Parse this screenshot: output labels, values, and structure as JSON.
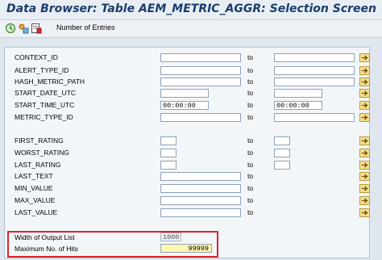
{
  "title": "Data Browser: Table AEM_METRIC_AGGR: Selection Screen",
  "toolbar": {
    "icons": [
      "execute-clock-icon",
      "selection-options-icon",
      "program-variant-icon"
    ],
    "entries_label": "Number of Entries"
  },
  "fields": [
    {
      "label": "CONTEXT_ID",
      "low": "",
      "to": "to",
      "high": ""
    },
    {
      "label": "ALERT_TYPE_ID",
      "low": "",
      "to": "to",
      "high": ""
    },
    {
      "label": "HASH_METRIC_PATH",
      "low": "",
      "to": "to",
      "high": ""
    },
    {
      "label": "START_DATE_UTC",
      "low": "",
      "to": "to",
      "high": ""
    },
    {
      "label": "START_TIME_UTC",
      "low": "00:00:00",
      "to": "to",
      "high": "00:00:00"
    },
    {
      "label": "METRIC_TYPE_ID",
      "low": "",
      "to": "to",
      "high": ""
    },
    {
      "label": "FIRST_RATING",
      "low": "",
      "to": "to",
      "high": ""
    },
    {
      "label": "WORST_RATING",
      "low": "",
      "to": "to",
      "high": ""
    },
    {
      "label": "LAST_RATING",
      "low": "",
      "to": "to",
      "high": ""
    },
    {
      "label": "LAST_TEXT",
      "low": "",
      "to": "to",
      "high": ""
    },
    {
      "label": "MIN_VALUE",
      "low": "",
      "to": "to",
      "high": ""
    },
    {
      "label": "MAX_VALUE",
      "low": "",
      "to": "to",
      "high": ""
    },
    {
      "label": "LAST_VALUE",
      "low": "",
      "to": "to",
      "high": ""
    }
  ],
  "output": {
    "width_label": "Width of Output List",
    "width_value": "1000",
    "maxhits_label": "Maximum No. of Hits",
    "maxhits_value": "99999"
  },
  "colors": {
    "title": "#1a3d6b",
    "multiple_selection_button": "#f6df8e",
    "highlight_box": "#d9262b",
    "max_hits_field": "#fff6b0"
  }
}
